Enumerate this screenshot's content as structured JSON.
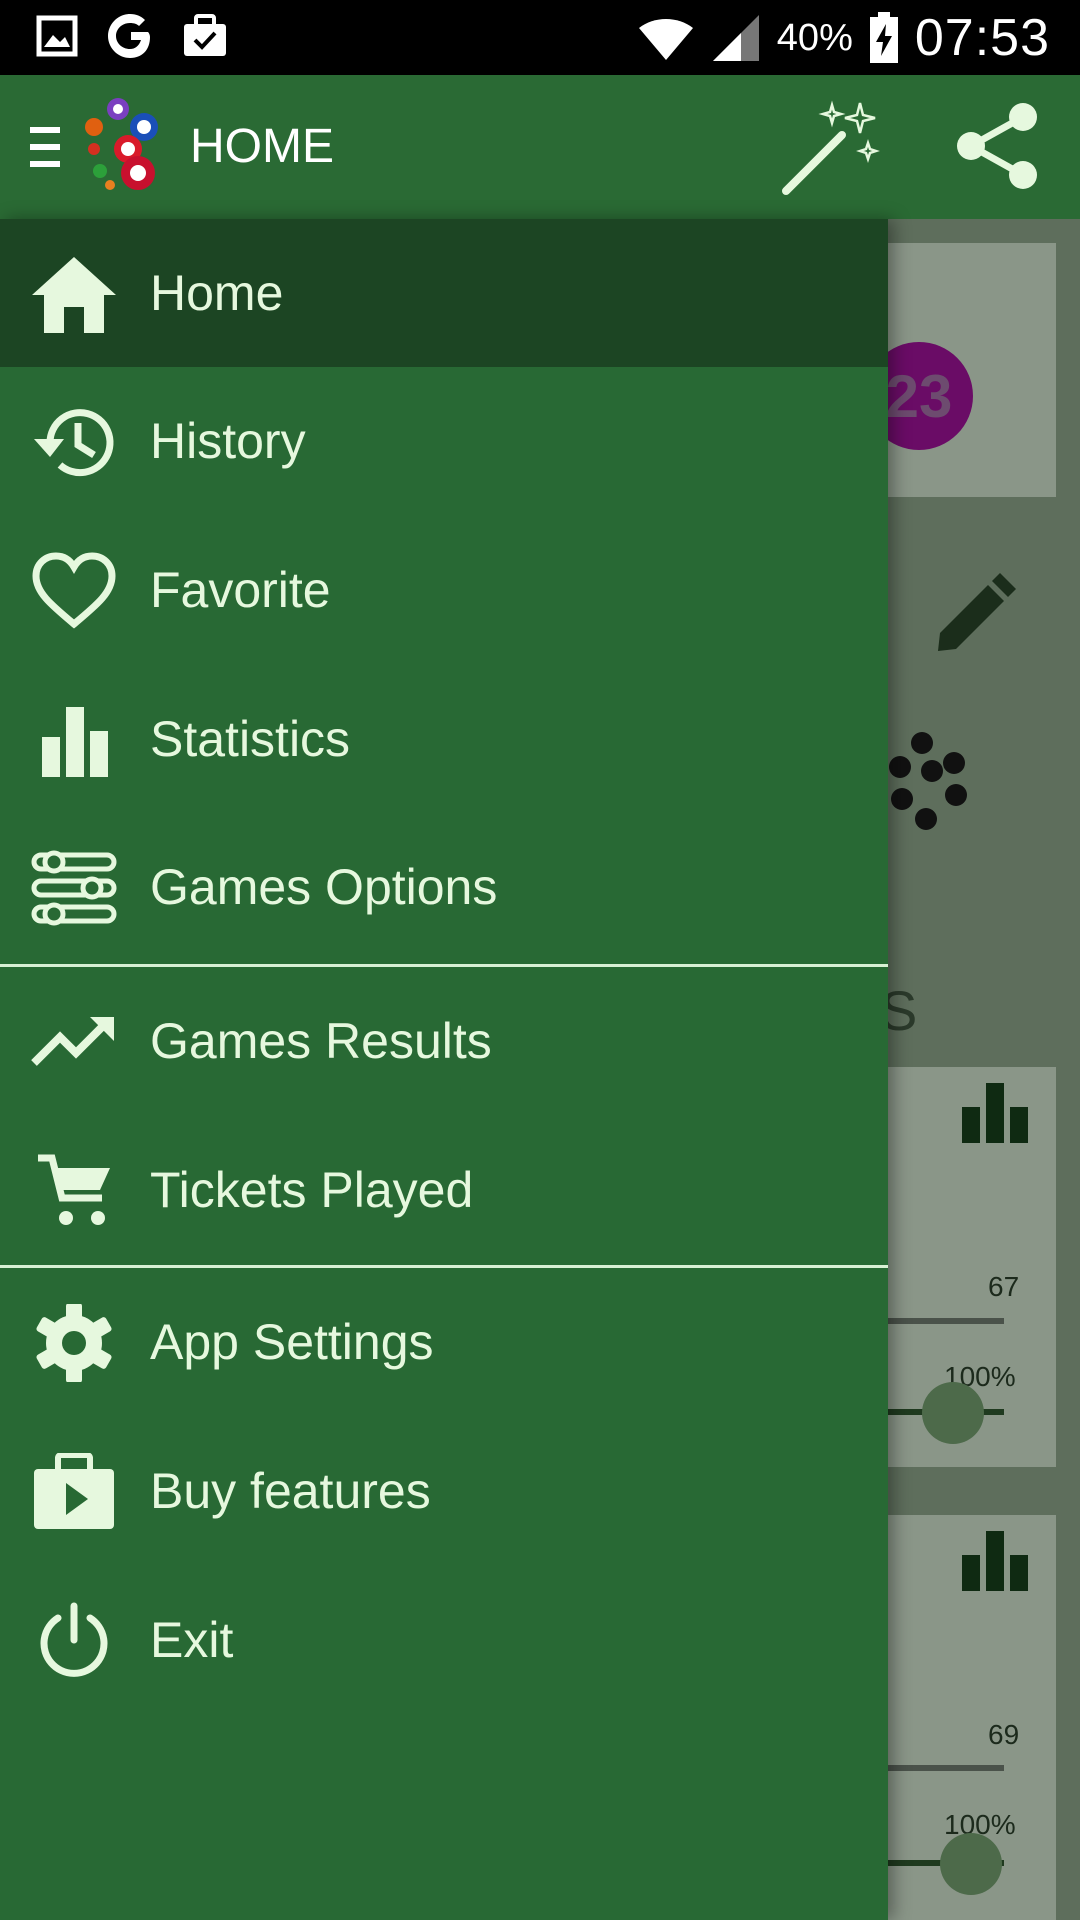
{
  "status_bar": {
    "battery": "40%",
    "time": "07:53",
    "left_icons": [
      "gallery-icon",
      "google-icon",
      "work-briefcase-icon"
    ],
    "right_icons": [
      "wifi-icon",
      "signal-icon",
      "battery-charging-icon"
    ]
  },
  "app_bar": {
    "title": "HOME",
    "icons": [
      "menu-icon",
      "lottery-balls-logo",
      "magic-wand-icon",
      "share-icon"
    ]
  },
  "drawer": {
    "items": [
      {
        "label": "Home",
        "icon": "home-icon",
        "active": true
      },
      {
        "label": "History",
        "icon": "history-icon"
      },
      {
        "label": "Favorite",
        "icon": "heart-icon"
      },
      {
        "label": "Statistics",
        "icon": "bar-chart-icon"
      },
      {
        "label": "Games Options",
        "icon": "sliders-icon"
      },
      {
        "label": "Games Results",
        "icon": "trending-up-icon"
      },
      {
        "label": "Tickets Played",
        "icon": "cart-icon"
      },
      {
        "label": "App Settings",
        "icon": "gear-icon"
      },
      {
        "label": "Buy features",
        "icon": "play-store-bag-icon"
      },
      {
        "label": "Exit",
        "icon": "power-icon"
      }
    ]
  },
  "background": {
    "ball_number": "23",
    "partial_letter": "S",
    "card1": {
      "count": "67",
      "percent": "100%"
    },
    "card2": {
      "count": "69",
      "percent": "100%"
    }
  },
  "colors": {
    "app_bar": "#2a6a34",
    "drawer": "#286934",
    "drawer_active": "#1c4523",
    "drawer_text": "#e6f8de"
  }
}
